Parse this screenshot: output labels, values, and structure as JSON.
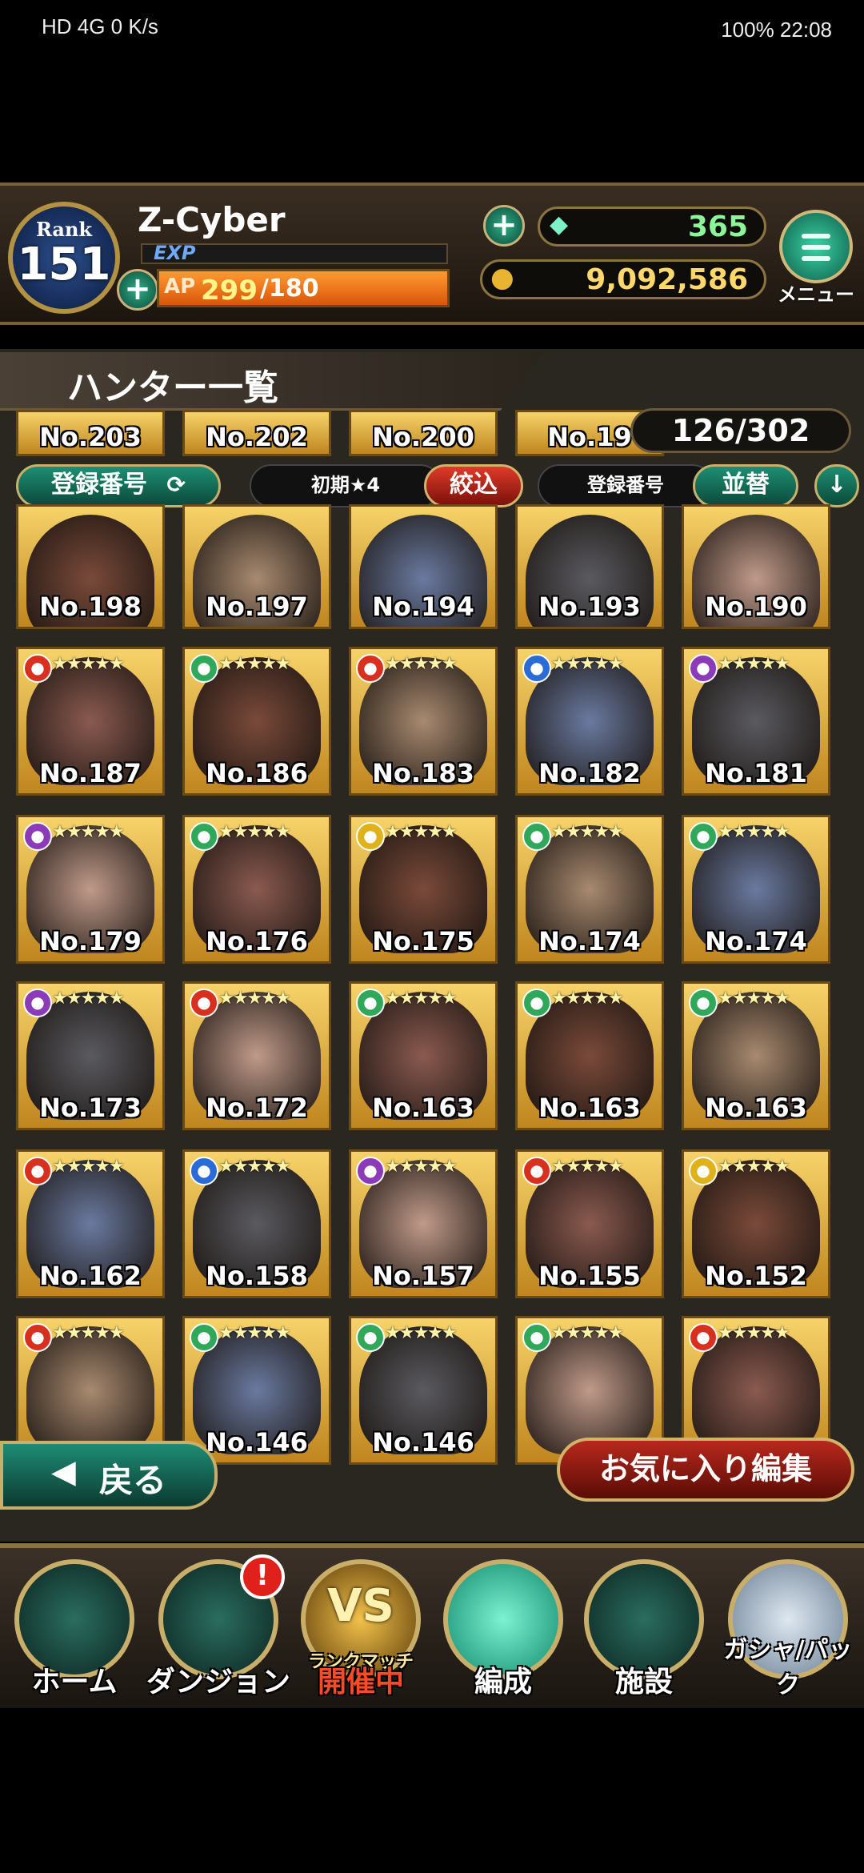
{
  "status_bar": {
    "left": "HD 4G 0 K/s",
    "right": "100%  22:08"
  },
  "player": {
    "rank_label": "Rank",
    "rank": "151",
    "name": "Z-Cyber",
    "exp_label": "EXP",
    "ap_label": "AP",
    "ap_current": "299",
    "ap_max": "/180"
  },
  "currency": {
    "gems": "365",
    "coins": "9,092,586"
  },
  "menu_label": "メニュー",
  "screen_title": "ハンター一覧",
  "count": "126/302",
  "filters": {
    "sort_key": "登録番号",
    "filter_value": "初期★4",
    "filter_button": "絞込",
    "order_key": "登録番号",
    "order_button": "並替"
  },
  "hunters_top_partial": [
    "No.203",
    "No.202",
    "No.200",
    "No.19"
  ],
  "hunters": [
    {
      "no": "No.198",
      "attr": "none",
      "stars": ""
    },
    {
      "no": "No.197",
      "attr": "none",
      "stars": ""
    },
    {
      "no": "No.194",
      "attr": "none",
      "stars": ""
    },
    {
      "no": "No.193",
      "attr": "none",
      "stars": ""
    },
    {
      "no": "No.190",
      "attr": "none",
      "stars": ""
    },
    {
      "no": "No.187",
      "attr": "fire",
      "stars": "★★★★★"
    },
    {
      "no": "No.186",
      "attr": "wind",
      "stars": "★★★★★"
    },
    {
      "no": "No.183",
      "attr": "fire",
      "stars": "★★★★★"
    },
    {
      "no": "No.182",
      "attr": "water",
      "stars": "★★★★★"
    },
    {
      "no": "No.181",
      "attr": "dark",
      "stars": "★★★★★"
    },
    {
      "no": "No.179",
      "attr": "dark",
      "stars": "★★★★★"
    },
    {
      "no": "No.176",
      "attr": "wind",
      "stars": "★★★★★"
    },
    {
      "no": "No.175",
      "attr": "light",
      "stars": "★★★★★"
    },
    {
      "no": "No.174",
      "attr": "wind",
      "stars": "★★★★★"
    },
    {
      "no": "No.174",
      "attr": "wind",
      "stars": "★★★★★"
    },
    {
      "no": "No.173",
      "attr": "dark",
      "stars": "★★★★★"
    },
    {
      "no": "No.172",
      "attr": "fire",
      "stars": "★★★★★"
    },
    {
      "no": "No.163",
      "attr": "wind",
      "stars": "★★★★★"
    },
    {
      "no": "No.163",
      "attr": "wind",
      "stars": "★★★★★"
    },
    {
      "no": "No.163",
      "attr": "wind",
      "stars": "★★★★★"
    },
    {
      "no": "No.162",
      "attr": "fire",
      "stars": "★★★★★"
    },
    {
      "no": "No.158",
      "attr": "water",
      "stars": "★★★★★"
    },
    {
      "no": "No.157",
      "attr": "dark",
      "stars": "★★★★★"
    },
    {
      "no": "No.155",
      "attr": "fire",
      "stars": "★★★★★"
    },
    {
      "no": "No.152",
      "attr": "light",
      "stars": "★★★★★"
    },
    {
      "no": "",
      "attr": "fire",
      "stars": "★★★★★"
    },
    {
      "no": "No.146",
      "attr": "wind",
      "stars": "★★★★★"
    },
    {
      "no": "No.146",
      "attr": "wind",
      "stars": "★★★★★"
    },
    {
      "no": "",
      "attr": "wind",
      "stars": "★★★★★"
    },
    {
      "no": "",
      "attr": "fire",
      "stars": "★★★★★"
    }
  ],
  "back_label": "戻る",
  "favorite_label": "お気に入り編集",
  "nav": {
    "home": "ホーム",
    "dungeon": "ダンジョン",
    "dungeon_badge": "!",
    "vs_logo": "VS",
    "vs_sub": "ランクマッチ",
    "vs_label": "開催中",
    "party": "編成",
    "facility": "施設",
    "gacha": "ガシャ/パック"
  },
  "colors": {
    "fire": "#d8301f",
    "wind": "#2fa85a",
    "water": "#2a6bd8",
    "dark": "#8b3ab8",
    "light": "#e0b21a",
    "accent_teal": "#1d8f73"
  }
}
